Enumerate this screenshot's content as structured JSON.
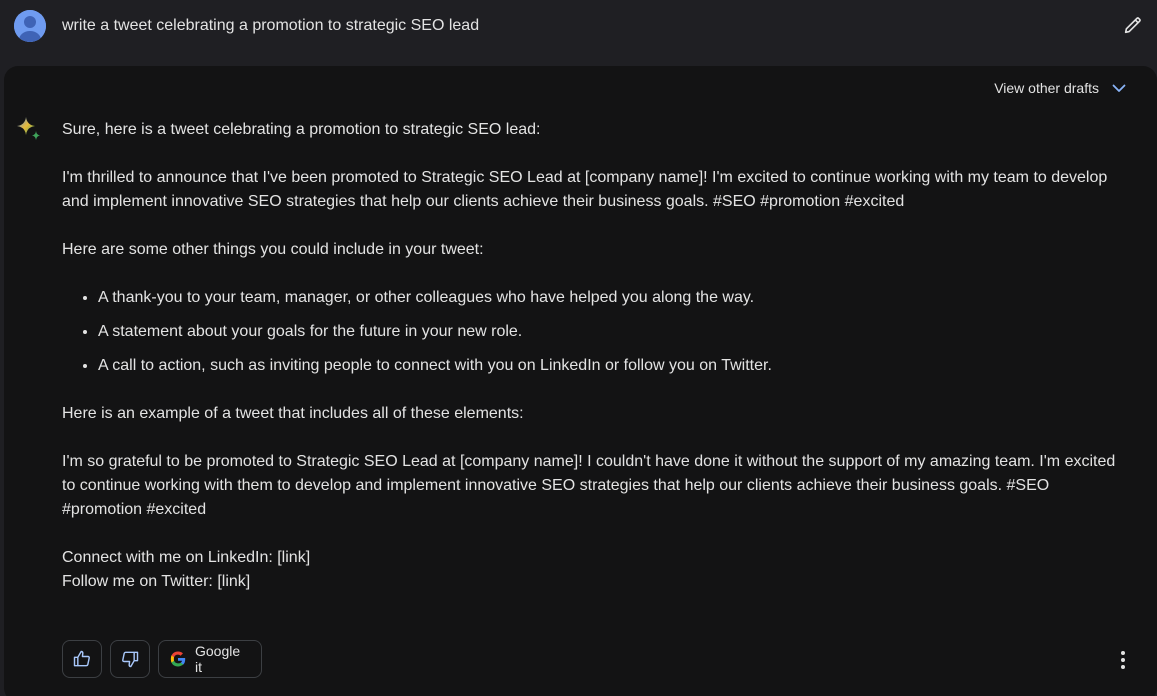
{
  "prompt": {
    "text": "write a tweet celebrating a promotion to strategic SEO lead"
  },
  "drafts": {
    "label": "View other drafts"
  },
  "response": {
    "intro": "Sure, here is a tweet celebrating a promotion to strategic SEO lead:",
    "tweet1": "I'm thrilled to announce that I've been promoted to Strategic SEO Lead at [company name]! I'm excited to continue working with my team to develop and implement innovative SEO strategies that help our clients achieve their business goals. #SEO #promotion #excited",
    "other_things": "Here are some other things you could include in your tweet:",
    "bullets": [
      "A thank-you to your team, manager, or other colleagues who have helped you along the way.",
      "A statement about your goals for the future in your new role.",
      "A call to action, such as inviting people to connect with you on LinkedIn or follow you on Twitter."
    ],
    "example_intro": "Here is an example of a tweet that includes all of these elements:",
    "tweet2": "I'm so grateful to be promoted to Strategic SEO Lead at [company name]! I couldn't have done it without the support of my amazing team. I'm excited to continue working with them to develop and implement innovative SEO strategies that help our clients achieve their business goals. #SEO #promotion #excited",
    "linkedin": "Connect with me on LinkedIn: [link]",
    "twitter": "Follow me on Twitter: [link]"
  },
  "actions": {
    "google_label": "Google it"
  },
  "colors": {
    "background": "#1f1f23",
    "card": "#131314",
    "text": "#e3e3e3",
    "accent_blue": "#8ab4f8"
  },
  "icons": {
    "avatar": "user-avatar",
    "edit": "pencil-icon",
    "drafts": "chevron-down-icon",
    "sparkle": "gemini-sparkle-icon",
    "thumbs_up": "thumbs-up-icon",
    "thumbs_down": "thumbs-down-icon",
    "google": "google-g-icon",
    "more": "more-vert-icon"
  }
}
